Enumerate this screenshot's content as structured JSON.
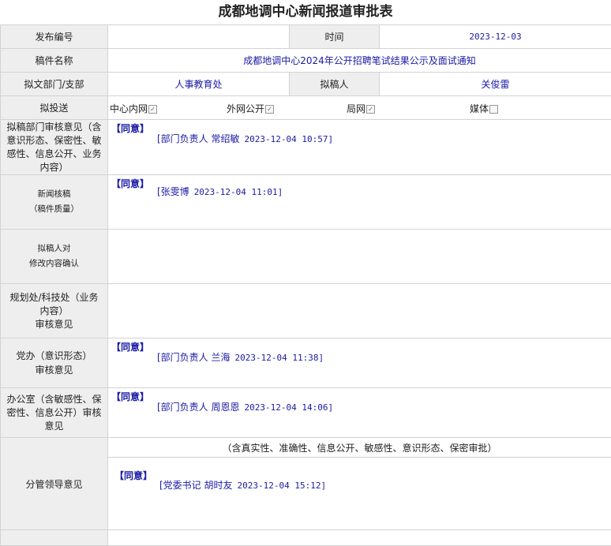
{
  "title": "成都地调中心新闻报道审批表",
  "labels": {
    "publish_no": "发布编号",
    "time": "时间",
    "manuscript_name": "稿件名称",
    "drafting_dept": "拟文部门/支部",
    "drafter": "拟稿人",
    "send_to": "拟投送",
    "dept_review": "拟稿部门审核意见（含意识形态、保密性、敏感性、信息公开、业务内容）",
    "news_review_1": "新闻核稿",
    "news_review_2": "（稿件质量）",
    "drafter_confirm_1": "拟稿人对",
    "drafter_confirm_2": "修改内容确认",
    "planning_review_1": "规划处/科技处（业务内容）",
    "planning_review_2": "审核意见",
    "party_office_1": "党办（意识形态）",
    "party_office_2": "审核意见",
    "office_review": "办公室（含敏感性、保密性、信息公开）审核意见",
    "leader_opinion": "分管领导意见"
  },
  "values": {
    "publish_no": "",
    "time": "2023-12-03",
    "manuscript_name": "成都地调中心2024年公开招聘笔试结果公示及面试通知",
    "drafting_dept": "人事教育处",
    "drafter": "关俊雷"
  },
  "send_options": [
    {
      "label": "中心内网",
      "checked": true
    },
    {
      "label": "外网公开",
      "checked": true
    },
    {
      "label": "局网",
      "checked": true
    },
    {
      "label": "媒体",
      "checked": false
    }
  ],
  "opinions": {
    "dept": {
      "agree": "【同意】",
      "signer": "[部门负责人 常绍敏",
      "time": "2023-12-04 10:57]"
    },
    "news": {
      "agree": "【同意】",
      "signer": "[张雯博",
      "time": "2023-12-04 11:01]"
    },
    "party": {
      "agree": "【同意】",
      "signer": "[部门负责人 兰海",
      "time": "2023-12-04 11:38]"
    },
    "office": {
      "agree": "【同意】",
      "signer": "[部门负责人 周恩恩",
      "time": "2023-12-04 14:06]"
    },
    "leader": {
      "note": "（含真实性、准确性、信息公开、敏感性、意识形态、保密审批）",
      "agree": "【同意】",
      "signer": "[党委书记 胡时友",
      "time": "2023-12-04 15:12]"
    }
  },
  "check_mark": "✓"
}
